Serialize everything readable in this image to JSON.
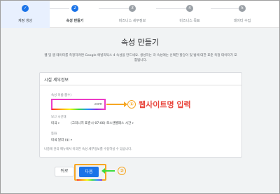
{
  "stepper": {
    "steps": [
      {
        "number": "✓",
        "label": "계정 생성"
      },
      {
        "number": "2",
        "label": "속성 만들기"
      },
      {
        "number": "3",
        "label": "비즈니스 세부정보"
      },
      {
        "number": "4",
        "label": "비즈니스 목표"
      },
      {
        "number": "5",
        "label": "데이터 수집"
      }
    ]
  },
  "header": {
    "title": "속성 만들기",
    "description": "웹 및 앱 데이터를 측정하려면 Google 애널리틱스 4 속성을 만드세요. 생성하는 각 속성에는 선택한 할당이 및 법에 대한 표준 측정 데이터가 포함됩니다."
  },
  "form": {
    "card_title": "시설 세부정보",
    "url_label": "속성 이름(필수)",
    "url_suffix": ".com",
    "timezone_label": "보고 시간대",
    "timezone_country": "미국",
    "timezone_value": "(그리니치 표준시-07:00) 로스앤젤레스 시간",
    "currency_label": "통화",
    "currency_value": "미국 달러 ($)",
    "footer_note": "나중에 관리 메뉴에서 이러한 속성 세부정보를 수정하실 수 있습니다."
  },
  "buttons": {
    "prev_label": "뒤로",
    "next_label": "다음"
  },
  "annotations": {
    "step1_marker": "①",
    "step1_text": "웹사이트명 입력",
    "step2_marker": "②"
  },
  "colors": {
    "accent": "#1a73e8",
    "annotation_orange": "#f6a623",
    "annotation_red": "#e8453c",
    "input_highlight": "#ec3cc6"
  }
}
